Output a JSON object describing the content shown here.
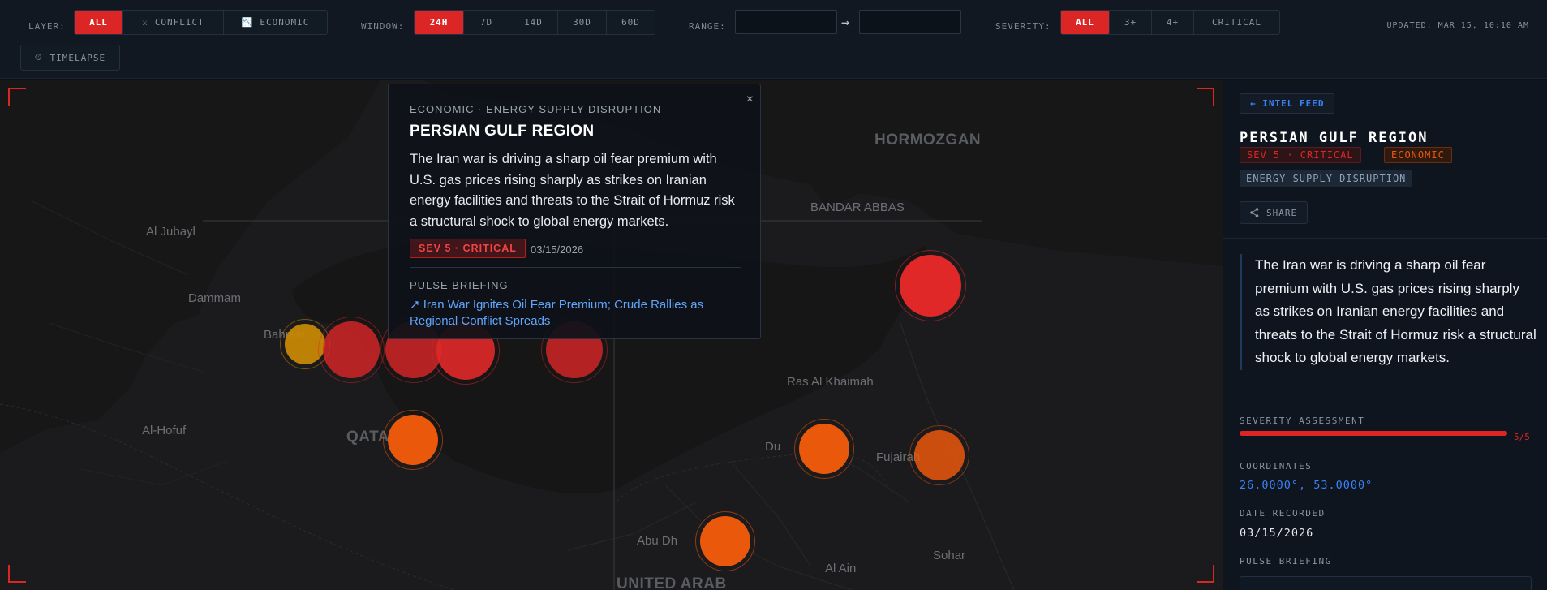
{
  "toolbar": {
    "layer": {
      "label": "LAYER:",
      "options": [
        {
          "label": "ALL",
          "icon": "",
          "active": true
        },
        {
          "label": "CONFLICT",
          "icon": "crossed-swords-icon",
          "glyph": "⚔",
          "active": false
        },
        {
          "label": "ECONOMIC",
          "icon": "chart-icon",
          "glyph": "📉",
          "active": false
        }
      ]
    },
    "window": {
      "label": "WINDOW:",
      "options": [
        {
          "label": "24H",
          "active": true
        },
        {
          "label": "7D",
          "active": false
        },
        {
          "label": "14D",
          "active": false
        },
        {
          "label": "30D",
          "active": false
        },
        {
          "label": "60D",
          "active": false
        }
      ]
    },
    "range": {
      "label": "RANGE:",
      "from_value": "",
      "to_value": "",
      "arrow": "→"
    },
    "severity": {
      "label": "SEVERITY:",
      "options": [
        {
          "label": "ALL",
          "active": true
        },
        {
          "label": "3+",
          "active": false
        },
        {
          "label": "4+",
          "active": false
        },
        {
          "label": "CRITICAL",
          "active": false
        }
      ]
    },
    "updated": "UPDATED: MAR 15, 10:10 AM",
    "timelapse": {
      "label": "TIMELAPSE",
      "icon": "stopwatch-icon",
      "glyph": "⏱"
    }
  },
  "map": {
    "cities": [
      "Al Jubayl",
      "Dammam",
      "Al-Hofuf",
      "Ras Al Khaimah",
      "BANDAR ABBAS",
      "Abu Dh",
      "Du",
      "Fujairah",
      "Al Ain",
      "Sohar",
      "Bahrain"
    ],
    "regions": [
      "HORMOZGAN",
      "QATAR",
      "UNITED ARAB"
    ],
    "markers": [
      {
        "severity": 3,
        "color": "#ca8a04"
      },
      {
        "severity": 5,
        "color": "#dc2626"
      },
      {
        "severity": 5,
        "color": "#dc2626"
      },
      {
        "severity": 5,
        "color": "#dc2626"
      },
      {
        "severity": 5,
        "color": "#dc2626"
      },
      {
        "severity": 5,
        "color": "#dc2626"
      },
      {
        "severity": 4,
        "color": "#ea580c"
      },
      {
        "severity": 4,
        "color": "#ea580c"
      },
      {
        "severity": 4,
        "color": "#ea580c"
      },
      {
        "severity": 4,
        "color": "#ea580c"
      }
    ]
  },
  "popup": {
    "category": "ECONOMIC · ENERGY SUPPLY DISRUPTION",
    "title": "PERSIAN GULF REGION",
    "body": "The Iran war is driving a sharp oil fear premium with U.S. gas prices rising sharply as strikes on Iranian energy facilities and threats to the Strait of Hormuz risk a structural shock to global energy markets.",
    "severity_badge": "SEV 5 · CRITICAL",
    "date": "03/15/2026",
    "pulse_label": "PULSE BRIEFING",
    "link": "↗ Iran War Ignites Oil Fear Premium; Crude Rallies as Regional Conflict Spreads",
    "close": "×"
  },
  "panel": {
    "back": "← INTEL FEED",
    "title": "PERSIAN GULF REGION",
    "tags": {
      "severity": "SEV 5 · CRITICAL",
      "layer": "ECONOMIC",
      "category": "ENERGY SUPPLY DISRUPTION"
    },
    "share": "SHARE",
    "description": "The Iran war is driving a sharp oil fear premium with U.S. gas prices rising sharply as strikes on Iranian energy facilities and threats to the Strait of Hormuz risk a structural shock to global energy markets.",
    "severity_label": "SEVERITY ASSESSMENT",
    "severity_value": 5,
    "severity_max": 5,
    "severity_text": "5/5",
    "coordinates_label": "COORDINATES",
    "coordinates": "26.0000°, 53.0000°",
    "date_label": "DATE RECORDED",
    "date": "03/15/2026",
    "pulse_label": "PULSE BRIEFING"
  },
  "colors": {
    "accent": "#dc2626",
    "economic": "#ea580c",
    "link": "#3b82f6",
    "warning": "#ca8a04"
  }
}
